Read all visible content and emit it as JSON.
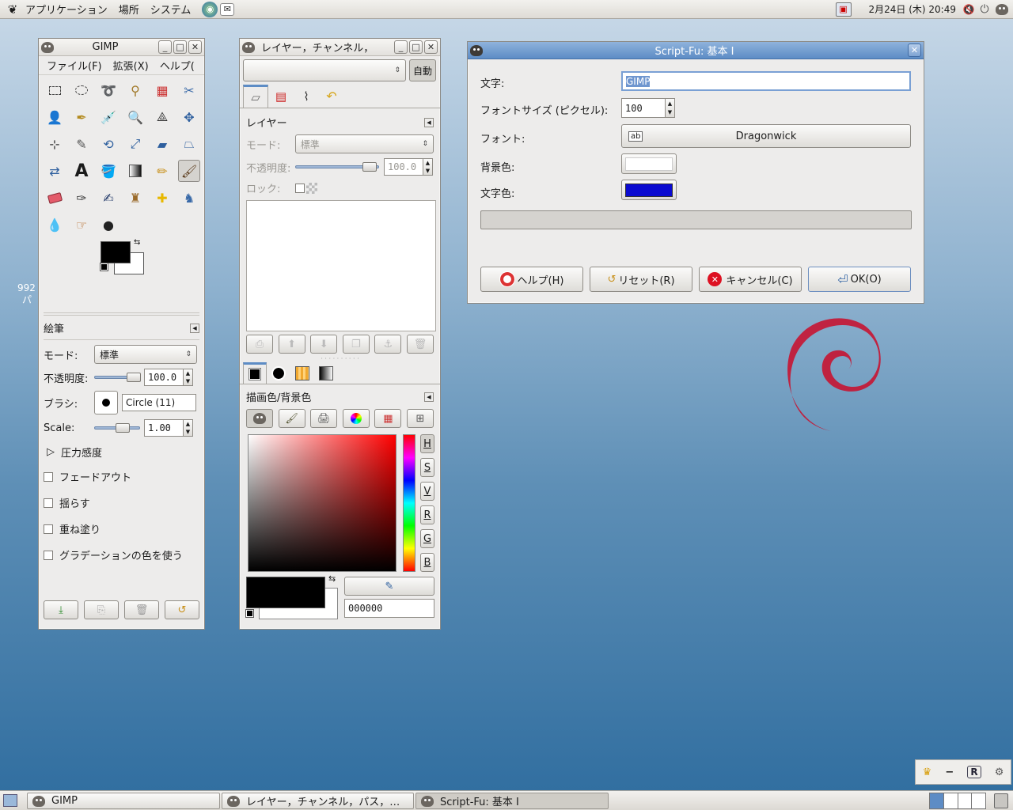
{
  "top_panel": {
    "menus": [
      "アプリケーション",
      "場所",
      "システム"
    ],
    "clock": "2月24日 (木) 20:49"
  },
  "desktop": {
    "partial_icon_text_1": "992",
    "partial_icon_text_2": "パ"
  },
  "toolbox": {
    "title": "GIMP",
    "menus": [
      "ファイル(F)",
      "拡張(X)",
      "ヘルプ("
    ],
    "tool_options": {
      "title": "絵筆",
      "mode_label": "モード:",
      "mode_value": "標準",
      "opacity_label": "不透明度:",
      "opacity_value": "100.0",
      "brush_label": "ブラシ:",
      "brush_value": "Circle (11)",
      "scale_label": "Scale:",
      "scale_value": "1.00",
      "pressure_label": "圧力感度",
      "options": [
        "フェードアウト",
        "揺らす",
        "重ね塗り",
        "グラデーションの色を使う"
      ]
    }
  },
  "layers_window": {
    "title": "レイヤー，チャンネル，",
    "auto_button": "自動",
    "layers_title": "レイヤー",
    "mode_label": "モード:",
    "mode_value": "標準",
    "opacity_label": "不透明度:",
    "opacity_value": "100.0",
    "lock_label": "ロック:",
    "colors_title": "描画色/背景色",
    "hex_value": "000000",
    "channel_buttons": [
      "H",
      "S",
      "V",
      "R",
      "G",
      "B"
    ]
  },
  "script_fu": {
    "title": "Script-Fu: 基本 I",
    "text_label": "文字:",
    "text_value": "GIMP",
    "font_size_label": "フォントサイズ (ピクセル):",
    "font_size_value": "100",
    "font_label": "フォント:",
    "font_value": "Dragonwick",
    "bg_color_label": "背景色:",
    "text_color_label": "文字色:",
    "bg_color": "#ffffff",
    "text_color": "#0b0bd0",
    "buttons": {
      "help": "ヘルプ(H)",
      "reset": "リセット(R)",
      "cancel": "キャンセル(C)",
      "ok": "OK(O)"
    }
  },
  "taskbar": {
    "items": [
      "GIMP",
      "レイヤー，チャンネル，パス，…",
      "Script-Fu: 基本 I"
    ]
  },
  "colors": {
    "fg": "#000000",
    "bg": "#ffffff",
    "active_title": "#5d8cc5"
  }
}
